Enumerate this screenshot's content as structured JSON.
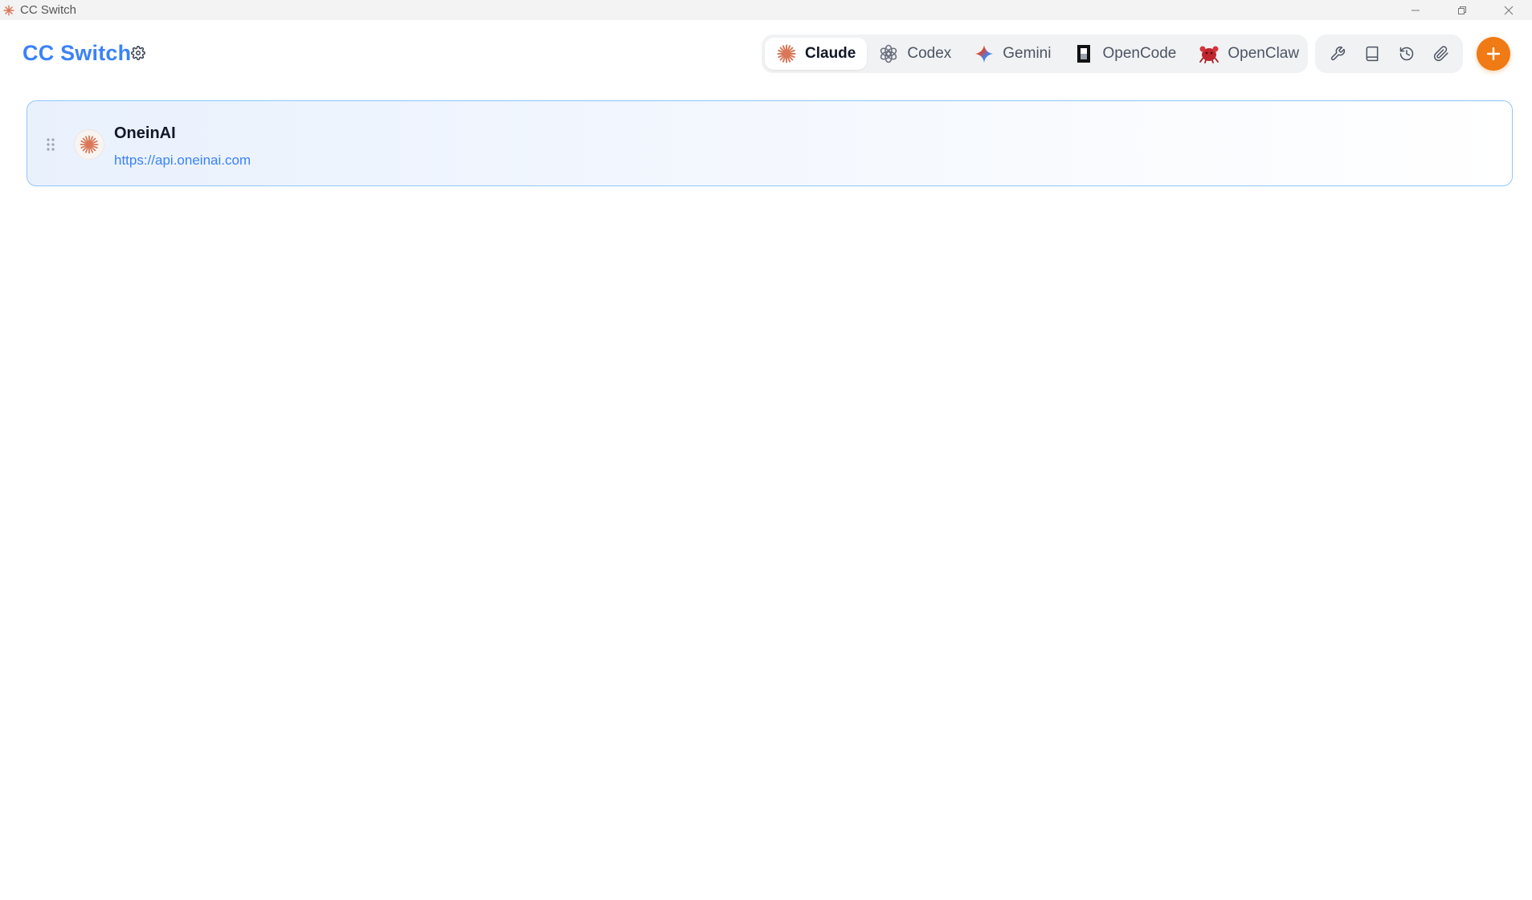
{
  "window": {
    "title": "CC Switch",
    "controls": [
      "minimize-icon",
      "restore-icon",
      "close-icon"
    ]
  },
  "header": {
    "brand": "CC Switch",
    "settings_icon": "gear-icon",
    "app_tabs": [
      {
        "label": "Claude",
        "icon": "claude-logo-icon",
        "active": true
      },
      {
        "label": "Codex",
        "icon": "openai-logo-icon",
        "active": false
      },
      {
        "label": "Gemini",
        "icon": "gemini-sparkle-icon",
        "active": false
      },
      {
        "label": "OpenCode",
        "icon": "opencode-logo-icon",
        "active": false
      },
      {
        "label": "OpenClaw",
        "icon": "openclaw-crab-icon",
        "active": false
      }
    ],
    "tools": [
      "wrench-icon",
      "book-icon",
      "history-icon",
      "paperclip-icon"
    ],
    "add_icon": "plus-icon"
  },
  "providers": [
    {
      "name": "OneinAI",
      "url": "https://api.oneinai.com",
      "icon": "claude-logo-icon",
      "selected": true
    }
  ],
  "colors": {
    "brand": "#3b82f6",
    "accent": "#f07a14",
    "claude": "#d97757",
    "selected_border": "#93c5fd"
  }
}
